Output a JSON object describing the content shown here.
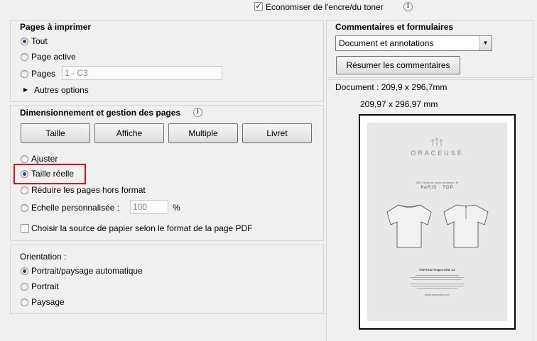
{
  "top": {
    "economize_label": "Economiser de l'encre/du toner",
    "economize_checked": true
  },
  "pages": {
    "title": "Pages à imprimer",
    "options": [
      "Tout",
      "Page active",
      "Pages"
    ],
    "range_value": "1 - C3",
    "more_options": "Autres options"
  },
  "sizing": {
    "title": "Dimensionnement et gestion des pages",
    "buttons": [
      "Taille",
      "Affiche",
      "Multiple",
      "Livret"
    ],
    "options": [
      "Ajuster",
      "Taille réelle",
      "Réduire les pages hors format",
      "Echelle personnalisée :"
    ],
    "scale_value": "100",
    "scale_unit": "%",
    "paper_source": "Choisir la source de papier selon le format de la page PDF"
  },
  "orientation": {
    "title": "Orientation :",
    "options": [
      "Portrait/paysage automatique",
      "Portrait",
      "Paysage"
    ]
  },
  "comments": {
    "title": "Commentaires et formulaires",
    "select_value": "Document et annotations",
    "summarize_button": "Résumer les commentaires"
  },
  "document": {
    "size_label": "Document : 209,9 x 296,7mm",
    "page_size": "209,97 x 296,97 mm"
  },
  "preview": {
    "brand": "ORACEUSE",
    "ref": "REF. Robe de l'acte communo. M",
    "title": "PARIS · TOP",
    "format": "PORTRAIT/Papier EDIt: A4",
    "website": "www.oraceuse.com"
  }
}
